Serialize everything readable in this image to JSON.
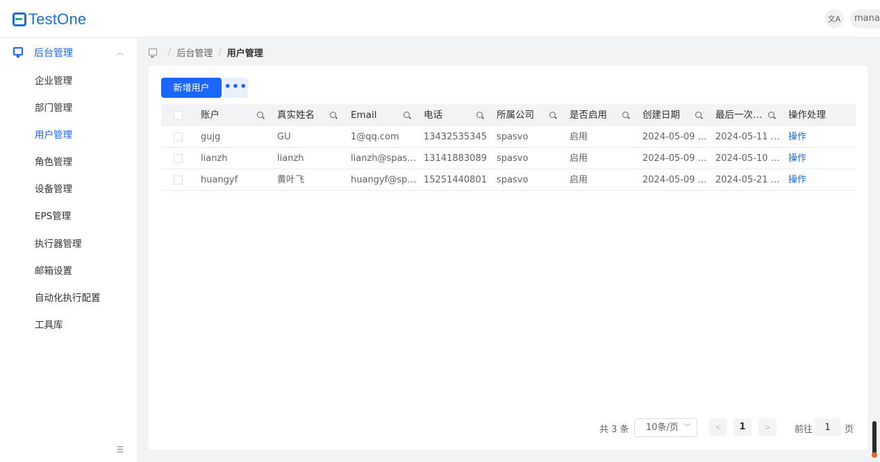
{
  "header": {
    "logo_text": "TestOne",
    "lang_icon": "translate-icon",
    "user_label": "manager"
  },
  "sidebar": {
    "group": {
      "label": "后台管理",
      "icon": "monitor-icon",
      "expanded": true
    },
    "items": [
      {
        "label": "企业管理",
        "active": false
      },
      {
        "label": "部门管理",
        "active": false
      },
      {
        "label": "用户管理",
        "active": true
      },
      {
        "label": "角色管理",
        "active": false
      },
      {
        "label": "设备管理",
        "active": false
      },
      {
        "label": "EPS管理",
        "active": false
      },
      {
        "label": "执行器管理",
        "active": false
      },
      {
        "label": "邮箱设置",
        "active": false
      },
      {
        "label": "自动化执行配置",
        "active": false
      },
      {
        "label": "工具库",
        "active": false
      }
    ],
    "collapse_icon": "menu-fold-icon"
  },
  "breadcrumb": {
    "icon": "monitor-icon",
    "parent": "后台管理",
    "current": "用户管理",
    "separator": "/"
  },
  "toolbar": {
    "add_label": "新增用户",
    "more_label": "•••"
  },
  "table": {
    "columns": [
      "账户",
      "真实姓名",
      "Email",
      "电话",
      "所属公司",
      "是否启用",
      "创建日期",
      "最后一次…",
      "操作处理"
    ],
    "rows": [
      [
        "gujg",
        "GU",
        "1@qq.com",
        "13432535345",
        "spasvo",
        "启用",
        "2024-05-09 …",
        "2024-05-11 …",
        "操作"
      ],
      [
        "lianzh",
        "lianzh",
        "lianzh@spas…",
        "13141883089",
        "spasvo",
        "启用",
        "2024-05-09 …",
        "2024-05-10 …",
        "操作"
      ],
      [
        "huangyf",
        "黄叶飞",
        "huangyf@sp…",
        "15251440801",
        "spasvo",
        "启用",
        "2024-05-09 …",
        "2024-05-21 …",
        "操作"
      ]
    ]
  },
  "pagination": {
    "total_text": "共 3 条",
    "page_size": "10条/页",
    "current_page": "1",
    "prev": "<",
    "next": ">",
    "goto_label": "前往",
    "goto_value": "1",
    "goto_suffix": "页"
  },
  "colors": {
    "primary": "#1a66ff",
    "logo_blue": "#1c6fd6",
    "logo_green": "#22b07d"
  }
}
